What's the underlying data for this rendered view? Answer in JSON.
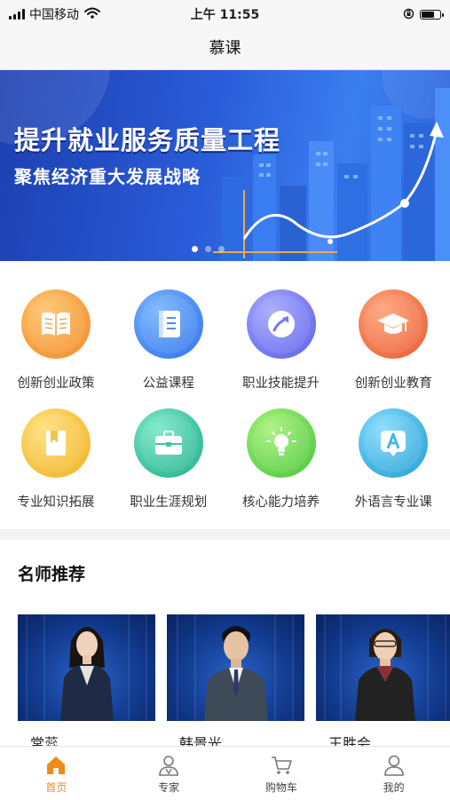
{
  "status_bar": {
    "carrier": "中国移动",
    "time": "上午 11:55"
  },
  "nav": {
    "title": "慕课"
  },
  "banner": {
    "title": "提升就业服务质量工程",
    "subtitle": "聚焦经济重大发展战略",
    "slide_count": 3,
    "active_slide": 0
  },
  "categories": [
    {
      "label": "创新创业政策",
      "icon": "book-icon",
      "color": "#f39a3a"
    },
    {
      "label": "公益课程",
      "icon": "notebook-icon",
      "color": "#3f86f0"
    },
    {
      "label": "职业技能提升",
      "icon": "upward-arrow-icon",
      "color": "#6b6ef0"
    },
    {
      "label": "创新创业教育",
      "icon": "graduation-cap-icon",
      "color": "#ef7446"
    },
    {
      "label": "专业知识拓展",
      "icon": "bookmark-icon",
      "color": "#f4c03c"
    },
    {
      "label": "职业生涯规划",
      "icon": "briefcase-icon",
      "color": "#2fc2a0"
    },
    {
      "label": "核心能力培养",
      "icon": "lightbulb-icon",
      "color": "#6cd85a"
    },
    {
      "label": "外语言专业课",
      "icon": "letter-a-icon",
      "color": "#37b3e0"
    }
  ],
  "section": {
    "title": "名师推荐"
  },
  "teachers": [
    {
      "name": "常蕊"
    },
    {
      "name": "韩景光"
    },
    {
      "name": "王胜会"
    }
  ],
  "tab_bar": {
    "items": [
      {
        "label": "首页",
        "icon": "home-icon",
        "active": true
      },
      {
        "label": "专家",
        "icon": "expert-icon",
        "active": false
      },
      {
        "label": "购物车",
        "icon": "cart-icon",
        "active": false
      },
      {
        "label": "我的",
        "icon": "profile-icon",
        "active": false
      }
    ],
    "active_color": "#f08a1a"
  }
}
